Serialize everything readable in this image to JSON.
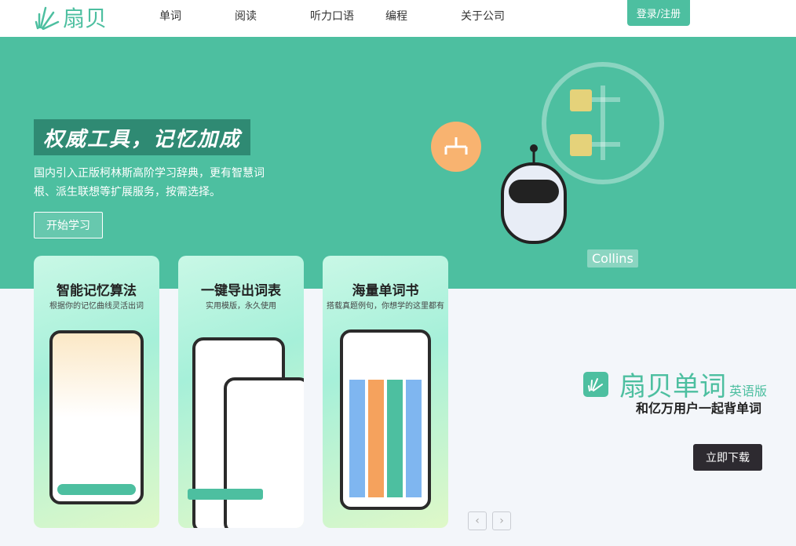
{
  "header": {
    "logo": "扇贝",
    "nav": [
      "单词",
      "阅读",
      "听力口语",
      "编程",
      "关于公司"
    ],
    "login": "登录/注册"
  },
  "hero": {
    "slogan": "权威工具，记忆加成",
    "description": "国内引入正版柯林斯高阶学习辞典，更有智慧词根、派生联想等扩展服务，按需选择。",
    "start_button": "开始学习",
    "badge": "Collins",
    "slide_index": 2,
    "slide_count": 3
  },
  "cards": [
    {
      "title": "智能记忆算法",
      "subtitle": "根据你的记忆曲线灵活出词"
    },
    {
      "title": "一键导出词表",
      "subtitle": "实用模版，永久使用"
    },
    {
      "title": "海量单词书",
      "subtitle": "搭载真题例句，你想学的这里都有"
    }
  ],
  "promo": {
    "brand": "扇贝单词",
    "edition": "英语版",
    "tagline": "和亿万用户一起背单词",
    "download": "立即下载"
  },
  "colors": {
    "accent": "#4dbfa0",
    "dark": "#2d2a30"
  }
}
